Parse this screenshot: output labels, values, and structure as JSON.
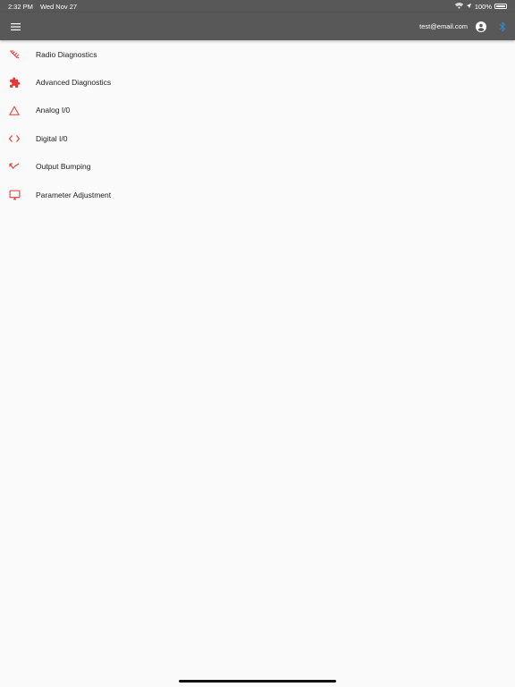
{
  "status_bar": {
    "time": "2:32 PM",
    "date": "Wed Nov 27",
    "battery": "100%"
  },
  "app_bar": {
    "user_email": "test@email.com"
  },
  "colors": {
    "accent": "#e53935",
    "bar": "#585858",
    "bluetooth": "#2196f3"
  },
  "menu": {
    "items": [
      {
        "label": "Radio Diagnostics",
        "icon": "radio-signal-icon"
      },
      {
        "label": "Advanced Diagnostics",
        "icon": "puzzle-icon"
      },
      {
        "label": "Analog I/0",
        "icon": "triangle-icon"
      },
      {
        "label": "Digital I/0",
        "icon": "code-brackets-icon"
      },
      {
        "label": "Output Bumping",
        "icon": "trend-down-icon"
      },
      {
        "label": "Parameter Adjustment",
        "icon": "monitor-icon"
      }
    ]
  }
}
